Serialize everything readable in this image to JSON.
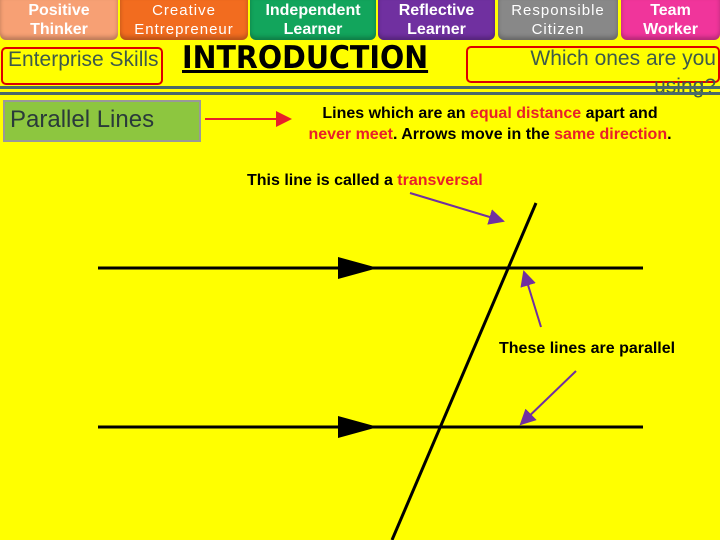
{
  "tabs": [
    {
      "label": "Positive Thinker",
      "color": "#f7a074"
    },
    {
      "label": "Creative Entrepreneur",
      "color": "#f26c1f"
    },
    {
      "label": "Independent Learner",
      "color": "#12a55c"
    },
    {
      "label": "Reflective Learner",
      "color": "#7030a0"
    },
    {
      "label": "Responsible Citizen",
      "color": "#888888"
    },
    {
      "label": "Team Worker",
      "color": "#f0359b"
    }
  ],
  "enterprise_skills": "Enterprise Skills",
  "title": "INTRODUCTION",
  "question": "Which ones are you using?",
  "topic": "Parallel Lines",
  "definition": {
    "p1": "Lines which are an ",
    "h1": "equal distance",
    "p2": " apart and ",
    "h2": "never meet",
    "p3": ". Arrows move in the ",
    "h3": "same direction",
    "p4": "."
  },
  "transversal": {
    "p1": "This line is called a ",
    "h1": "transversal"
  },
  "parallel_label": "These lines are parallel",
  "colors": {
    "highlight": "#e8202a",
    "arrow": "#7030a0",
    "topic_box": "#8dc63f"
  }
}
